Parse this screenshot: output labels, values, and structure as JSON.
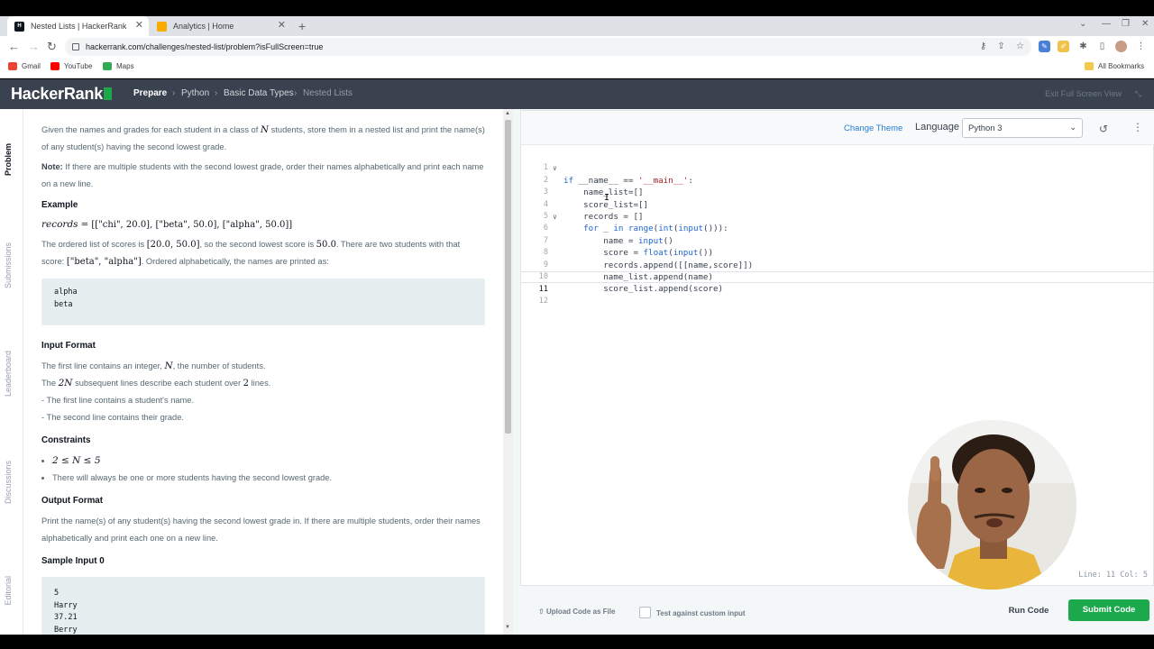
{
  "browser": {
    "tabs": [
      {
        "label": "Nested Lists | HackerRank",
        "favicon": "HR",
        "active": true
      },
      {
        "label": "Analytics | Home",
        "favicon": "bar-chart",
        "active": false
      }
    ],
    "url": "hackerrank.com/challenges/nested-list/problem?isFullScreen=true",
    "bookmarks": [
      "Gmail",
      "YouTube",
      "Maps"
    ],
    "all_bookmarks": "All Bookmarks"
  },
  "header": {
    "logo": "HackerRank",
    "breadcrumbs": [
      "Prepare",
      "Python",
      "Basic Data Types",
      "Nested Lists"
    ],
    "exit_full_screen": "Exit Full Screen View"
  },
  "rail": [
    "Problem",
    "Submissions",
    "Leaderboard",
    "Discussions",
    "Editorial"
  ],
  "problem": {
    "intro_a": "Given the names and grades for each student in a class of ",
    "intro_var": "N",
    "intro_b": " students, store them in a nested list and print the name(s) of any student(s) having the second lowest grade.",
    "note_label": "Note:",
    "note_text": " If there are multiple students with the second lowest grade, order their names alphabetically and print each name on a new line.",
    "example_heading": "Example",
    "example_records_var": "records",
    "example_records_val": " = [[\"chi\", 20.0], [\"beta\", 50.0], [\"alpha\", 50.0]]",
    "scores_a": "The ordered list of scores is ",
    "scores_list": "[20.0, 50.0]",
    "scores_b": ", so the second lowest score is ",
    "scores_val": "50.0",
    "scores_c": ". There are two students with that score: ",
    "scores_names": "[\"beta\", \"alpha\"]",
    "scores_d": ". Ordered alphabetically, the names are printed as:",
    "example_output": [
      "alpha",
      "beta"
    ],
    "input_heading": "Input Format",
    "input_line1_a": "The first line contains an integer, ",
    "input_line1_var": "N",
    "input_line1_b": ", the number of students.",
    "input_line2_a": "The ",
    "input_line2_var": "2N",
    "input_line2_b": " subsequent lines describe each student over ",
    "input_line2_num": "2",
    "input_line2_c": " lines.",
    "input_line3": "- The first line contains a student's name.",
    "input_line4": "- The second line contains their grade.",
    "constraints_heading": "Constraints",
    "constraint1": "2 ≤ N ≤ 5",
    "constraint2": "There will always be one or more students having the second lowest grade.",
    "output_heading": "Output Format",
    "output_text": "Print the name(s) of any student(s) having the second lowest grade in. If there are multiple students, order their names alphabetically and print each one on a new line.",
    "sample_heading": "Sample Input 0",
    "sample_input": [
      "5",
      "Harry",
      "37.21",
      "Berry"
    ]
  },
  "editor": {
    "change_theme": "Change Theme",
    "language_label": "Language",
    "language_value": "Python 3",
    "line_col": "Line: 11 Col: 5",
    "lines": [
      "1",
      "2",
      "3",
      "4",
      "5",
      "6",
      "7",
      "8",
      "9",
      "10",
      "11",
      "12"
    ]
  },
  "actions": {
    "upload": "Upload Code as File",
    "custom_input": "Test against custom input",
    "run": "Run Code",
    "submit": "Submit Code"
  },
  "colors": {
    "hr_header": "#39424e",
    "hr_green": "#1ba94c",
    "link_blue": "#1f7ad6"
  }
}
